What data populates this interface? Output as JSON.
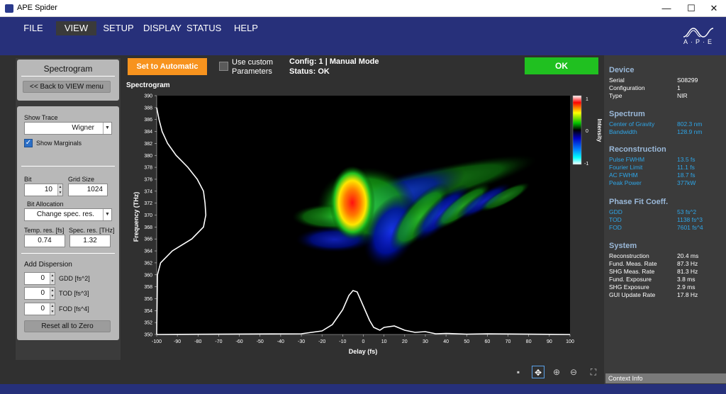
{
  "window": {
    "title": "APE Spider",
    "min": "—",
    "max": "☐",
    "close": "✕"
  },
  "menu": [
    "FILE",
    "VIEW",
    "SETUP",
    "DISPLAY",
    "STATUS",
    "HELP"
  ],
  "brand": {
    "logo_text": "A·P·E"
  },
  "left": {
    "title": "Spectrogram",
    "back_button": "<< Back to VIEW menu",
    "show_trace_label": "Show Trace",
    "show_trace_value": "Wigner",
    "show_marginals_label": "Show Marginals",
    "bit_label": "Bit",
    "bit_value": "10",
    "grid_size_label": "Grid Size",
    "grid_size_value": "1024",
    "bit_allocation_label": "Bit Allocation",
    "bit_allocation_value": "Change spec. res.",
    "temp_res_label": "Temp. res. [fs]",
    "temp_res_value": "0.74",
    "spec_res_label": "Spec. res. [THz]",
    "spec_res_value": "1.32",
    "add_dispersion_label": "Add Dispersion",
    "gdd_label": "GDD [fs^2]",
    "gdd_value": "0",
    "tod_label": "TOD [fs^3]",
    "tod_value": "0",
    "fod_label": "FOD [fs^4]",
    "fod_value": "0",
    "reset_button": "Reset all to Zero"
  },
  "top": {
    "set_auto": "Set to Automatic",
    "custom_label_1": "Use custom",
    "custom_label_2": "Parameters",
    "config_line": "Config: 1 | Manual Mode",
    "status_line": "Status: OK",
    "ok_button": "OK",
    "plot_title": "Spectrogram"
  },
  "chart_data": {
    "type": "heatmap",
    "title": "Spectrogram",
    "xlabel": "Delay (fs)",
    "ylabel": "Frequency (THz)",
    "xlim": [
      -100,
      100
    ],
    "ylim": [
      350,
      390
    ],
    "xticks": [
      -100,
      -90,
      -80,
      -70,
      -60,
      -50,
      -40,
      -30,
      -20,
      -10,
      0,
      10,
      20,
      30,
      40,
      50,
      60,
      70,
      80,
      90,
      100
    ],
    "yticks": [
      350,
      352,
      354,
      356,
      358,
      360,
      362,
      364,
      366,
      368,
      370,
      372,
      374,
      376,
      378,
      380,
      382,
      384,
      386,
      388,
      390
    ],
    "colorbar": {
      "label": "Intensity",
      "ticks": [
        "1",
        "0",
        "-1"
      ],
      "range": [
        -1,
        1
      ]
    },
    "spectral_marginal": {
      "freq": [
        350,
        360,
        362,
        364,
        366,
        368,
        370,
        372,
        374,
        376,
        378,
        380,
        382,
        384,
        386,
        388
      ],
      "value": [
        0.0,
        0.01,
        0.05,
        0.2,
        0.45,
        0.6,
        0.63,
        0.62,
        0.6,
        0.52,
        0.4,
        0.25,
        0.14,
        0.07,
        0.03,
        0.0
      ]
    },
    "temporal_marginal": {
      "delay": [
        -100,
        -30,
        -20,
        -15,
        -10,
        -7,
        -5,
        -3,
        0,
        3,
        5,
        8,
        10,
        15,
        20,
        25,
        30,
        35,
        40,
        50,
        60,
        100
      ],
      "value": [
        0.0,
        0.01,
        0.05,
        0.14,
        0.35,
        0.55,
        0.62,
        0.6,
        0.4,
        0.2,
        0.1,
        0.06,
        0.1,
        0.12,
        0.06,
        0.03,
        0.04,
        0.01,
        0.015,
        0.005,
        0.01,
        0.0
      ]
    },
    "grid": false
  },
  "right": {
    "device_head": "Device",
    "device_rows": [
      [
        "Serial",
        "S08299"
      ],
      [
        "Configuration",
        "1"
      ],
      [
        "Type",
        "NIR"
      ]
    ],
    "spectrum_head": "Spectrum",
    "spectrum_rows": [
      [
        "Center of Gravity",
        "802.3 nm"
      ],
      [
        "Bandwidth",
        "128.9 nm"
      ]
    ],
    "recon_head": "Reconstruction",
    "recon_rows": [
      [
        "Pulse FWHM",
        "13.5 fs"
      ],
      [
        "Fourier Limit",
        "11.1 fs"
      ],
      [
        "AC FWHM",
        "18.7 fs"
      ],
      [
        "Peak Power",
        "377kW"
      ]
    ],
    "phase_head": "Phase Fit Coeff.",
    "phase_rows": [
      [
        "GDD",
        "53 fs^2"
      ],
      [
        "TOD",
        "1138 fs^3"
      ],
      [
        "FOD",
        "7601 fs^4"
      ]
    ],
    "system_head": "System",
    "system_rows": [
      [
        "Reconstruction",
        "20.4 ms"
      ],
      [
        "Fund. Meas. Rate",
        "87.3 Hz"
      ],
      [
        "SHG Meas. Rate",
        "81.3 Hz"
      ],
      [
        "Fund. Exposure",
        "3.8 ms"
      ],
      [
        "SHG Exposure",
        "2.9 ms"
      ],
      [
        "GUI Update Rate",
        "17.8 Hz"
      ]
    ],
    "context_info": "Context Info"
  },
  "tools": [
    "save-icon",
    "move-icon",
    "zoom-in-icon",
    "zoom-out-icon",
    "zoom-fit-icon"
  ]
}
